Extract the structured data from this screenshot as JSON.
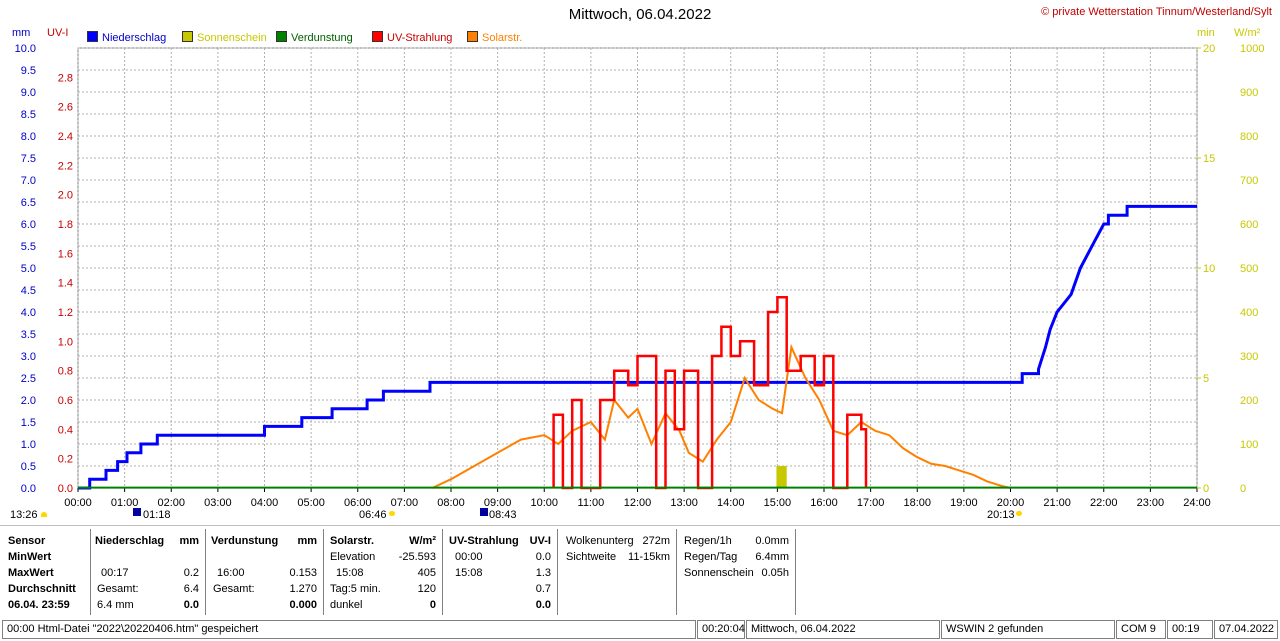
{
  "title": "Mittwoch, 06.04.2022",
  "copyright": "© private Wetterstation Tinnum/Westerland/Sylt",
  "axis_units": {
    "mm": "mm",
    "uv": "UV-I",
    "min": "min",
    "wm2": "W/m²"
  },
  "legend": [
    {
      "label": "Niederschlag",
      "color": "#0000ff"
    },
    {
      "label": "Sonnenschein",
      "color": "#c8c800"
    },
    {
      "label": "Verdunstung",
      "color": "#008000"
    },
    {
      "label": "UV-Strahlung",
      "color": "#ff0000"
    },
    {
      "label": "Solarstr.",
      "color": "#ff8000"
    }
  ],
  "sun_markers": {
    "left": "13:26",
    "sunrise": "06:46",
    "sunset": "20:13",
    "moon1": "01:18",
    "moon2": "08:43"
  },
  "chart_data": {
    "type": "line",
    "title": "Mittwoch, 06.04.2022",
    "x_ticks": [
      "00:00",
      "01:00",
      "02:00",
      "03:00",
      "04:00",
      "05:00",
      "06:00",
      "07:00",
      "08:00",
      "09:00",
      "10:00",
      "11:00",
      "12:00",
      "13:00",
      "14:00",
      "15:00",
      "16:00",
      "17:00",
      "18:00",
      "19:00",
      "20:00",
      "21:00",
      "22:00",
      "23:00",
      "24:00"
    ],
    "xlim": [
      0,
      24
    ],
    "axes": {
      "mm": {
        "ylim": [
          0,
          10
        ],
        "ticks": [
          "0.0",
          "0.5",
          "1.0",
          "1.5",
          "2.0",
          "2.5",
          "3.0",
          "3.5",
          "4.0",
          "4.5",
          "5.0",
          "5.5",
          "6.0",
          "6.5",
          "7.0",
          "7.5",
          "8.0",
          "8.5",
          "9.0",
          "9.5",
          "10.0"
        ],
        "color": "#0000c8"
      },
      "uv": {
        "ylim": [
          0,
          3.0
        ],
        "ticks": [
          "0.0",
          "0.2",
          "0.4",
          "0.6",
          "0.8",
          "1.0",
          "1.2",
          "1.4",
          "1.6",
          "1.8",
          "2.0",
          "2.2",
          "2.4",
          "2.6",
          "2.8"
        ],
        "color": "#c80000"
      },
      "min": {
        "ylim": [
          0,
          20
        ],
        "ticks": [
          "0",
          "5",
          "10",
          "15",
          "20"
        ],
        "color": "#c8c800"
      },
      "wm2": {
        "ylim": [
          0,
          1000
        ],
        "ticks": [
          "0",
          "100",
          "200",
          "300",
          "400",
          "500",
          "600",
          "700",
          "800",
          "900",
          "1000"
        ],
        "color": "#c8c800"
      }
    },
    "series": [
      {
        "name": "Niederschlag",
        "axis": "mm",
        "color": "#0000ff",
        "x": [
          0,
          0.25,
          0.25,
          0.6,
          0.6,
          0.85,
          0.85,
          1.05,
          1.05,
          1.35,
          1.35,
          1.7,
          1.7,
          4.0,
          4.0,
          4.8,
          4.8,
          5.45,
          5.45,
          6.2,
          6.2,
          6.55,
          6.55,
          7.55,
          7.55,
          20.25,
          20.25,
          20.6,
          20.6,
          20.75,
          20.85,
          21.0,
          21.3,
          21.5,
          21.8,
          22.0,
          22.1,
          22.1,
          22.5,
          22.5,
          24
        ],
        "y": [
          0,
          0,
          0.2,
          0.2,
          0.4,
          0.4,
          0.6,
          0.6,
          0.8,
          0.8,
          1.0,
          1.0,
          1.2,
          1.2,
          1.4,
          1.4,
          1.6,
          1.6,
          1.8,
          1.8,
          2.0,
          2.0,
          2.2,
          2.2,
          2.4,
          2.4,
          2.6,
          2.6,
          2.7,
          3.2,
          3.6,
          4.0,
          4.4,
          5.0,
          5.6,
          6.0,
          6.0,
          6.2,
          6.2,
          6.4,
          6.4
        ]
      },
      {
        "name": "Solarstr.",
        "axis": "wm2",
        "color": "#ff8000",
        "x": [
          7.6,
          8.0,
          8.5,
          9.0,
          9.5,
          10.0,
          10.3,
          10.6,
          11.0,
          11.3,
          11.5,
          11.8,
          12.0,
          12.3,
          12.6,
          12.9,
          13.1,
          13.4,
          13.7,
          14.0,
          14.3,
          14.6,
          14.9,
          15.1,
          15.3,
          15.6,
          15.9,
          16.2,
          16.5,
          16.8,
          17.1,
          17.4,
          17.7,
          18.0,
          18.3,
          18.6,
          18.9,
          19.2,
          19.5,
          19.8,
          20.0
        ],
        "y": [
          0,
          20,
          50,
          80,
          110,
          120,
          100,
          130,
          150,
          110,
          200,
          160,
          180,
          100,
          170,
          130,
          80,
          60,
          110,
          150,
          250,
          200,
          180,
          170,
          320,
          250,
          200,
          130,
          120,
          150,
          130,
          120,
          90,
          70,
          55,
          50,
          40,
          30,
          15,
          5,
          0
        ]
      },
      {
        "name": "UV-Strahlung",
        "axis": "uv",
        "color": "#ff0000",
        "x": [
          10.2,
          10.2,
          10.4,
          10.4,
          10.6,
          10.6,
          10.8,
          10.8,
          11.2,
          11.2,
          11.5,
          11.5,
          11.8,
          11.8,
          12.0,
          12.0,
          12.4,
          12.4,
          12.6,
          12.6,
          12.8,
          12.8,
          13.0,
          13.0,
          13.3,
          13.3,
          13.6,
          13.6,
          13.8,
          13.8,
          14.0,
          14.0,
          14.2,
          14.2,
          14.5,
          14.5,
          14.8,
          14.8,
          15.0,
          15.0,
          15.2,
          15.2,
          15.5,
          15.5,
          15.8,
          15.8,
          16.0,
          16.0,
          16.2,
          16.2,
          16.5,
          16.5,
          16.8,
          16.8,
          16.9,
          16.9
        ],
        "y": [
          0,
          0.5,
          0.5,
          0,
          0,
          0.6,
          0.6,
          0,
          0,
          0.6,
          0.6,
          0.8,
          0.8,
          0.7,
          0.7,
          0.9,
          0.9,
          0,
          0,
          0.8,
          0.8,
          0.4,
          0.4,
          0.8,
          0.8,
          0,
          0,
          0.9,
          0.9,
          1.1,
          1.1,
          0.9,
          0.9,
          1.0,
          1.0,
          0.7,
          0.7,
          1.2,
          1.2,
          1.3,
          1.3,
          0.8,
          0.8,
          0.9,
          0.9,
          0.7,
          0.7,
          0.9,
          0.9,
          0,
          0,
          0.5,
          0.5,
          0.4,
          0.4,
          0
        ]
      },
      {
        "name": "Sonnenschein",
        "axis": "min",
        "color": "#c8c800",
        "x": [
          14.98,
          15.2
        ],
        "y": [
          1.0,
          1.0
        ]
      },
      {
        "name": "Verdunstung",
        "axis": "mm",
        "color": "#008000",
        "x": [
          0,
          24
        ],
        "y": [
          0.01,
          0.01
        ]
      }
    ]
  },
  "panel": {
    "labels": {
      "sensor": "Sensor",
      "min": "MinWert",
      "max": "MaxWert",
      "avg": "Durchschnitt",
      "date": "06.04. 23:59"
    },
    "nied": {
      "title": "Niederschlag",
      "unit": "mm",
      "max_time": "00:17",
      "max_val": "0.2",
      "ges_label": "Gesamt:",
      "ges_val": "6.4",
      "avg_label": "6.4 mm",
      "avg_val": "0.0"
    },
    "verd": {
      "title": "Verdunstung",
      "unit": "mm",
      "max_time": "16:00",
      "max_val": "0.153",
      "ges_label": "Gesamt:",
      "ges_val": "1.270",
      "avg_val": "0.000"
    },
    "solar": {
      "title": "Solarstr.",
      "unit": "W/m²",
      "elev_label": "Elevation",
      "elev_val": "-25.593",
      "max_time": "15:08",
      "max_val": "405",
      "tag_label": "Tag:5 min.",
      "tag_val": "120",
      "dunkel_label": "dunkel",
      "dunkel_val": "0"
    },
    "uv": {
      "title": "UV-Strahlung",
      "unit": "UV-I",
      "min_time": "00:00",
      "min_val": "0.0",
      "max_time": "15:08",
      "max_val": "1.3",
      "ges_val": "0.7",
      "avg_val": "0.0"
    },
    "wolk": {
      "l1": "Wolkenunterg",
      "v1": "272m",
      "l2": "Sichtweite",
      "v2": "11-15km"
    },
    "regen": {
      "l1": "Regen/1h",
      "v1": "0.0mm",
      "l2": "Regen/Tag",
      "v2": "6.4mm",
      "l3": "Sonnenschein",
      "v3": "0.05h"
    }
  },
  "status": {
    "s1": "00:00  Html-Datei  \"2022\\20220406.htm\"  gespeichert",
    "s2": "00:20:04",
    "s3": "Mittwoch, 06.04.2022",
    "s4": "WSWIN 2 gefunden",
    "s5": "COM 9",
    "s6": "00:19",
    "s7": "07.04.2022"
  }
}
